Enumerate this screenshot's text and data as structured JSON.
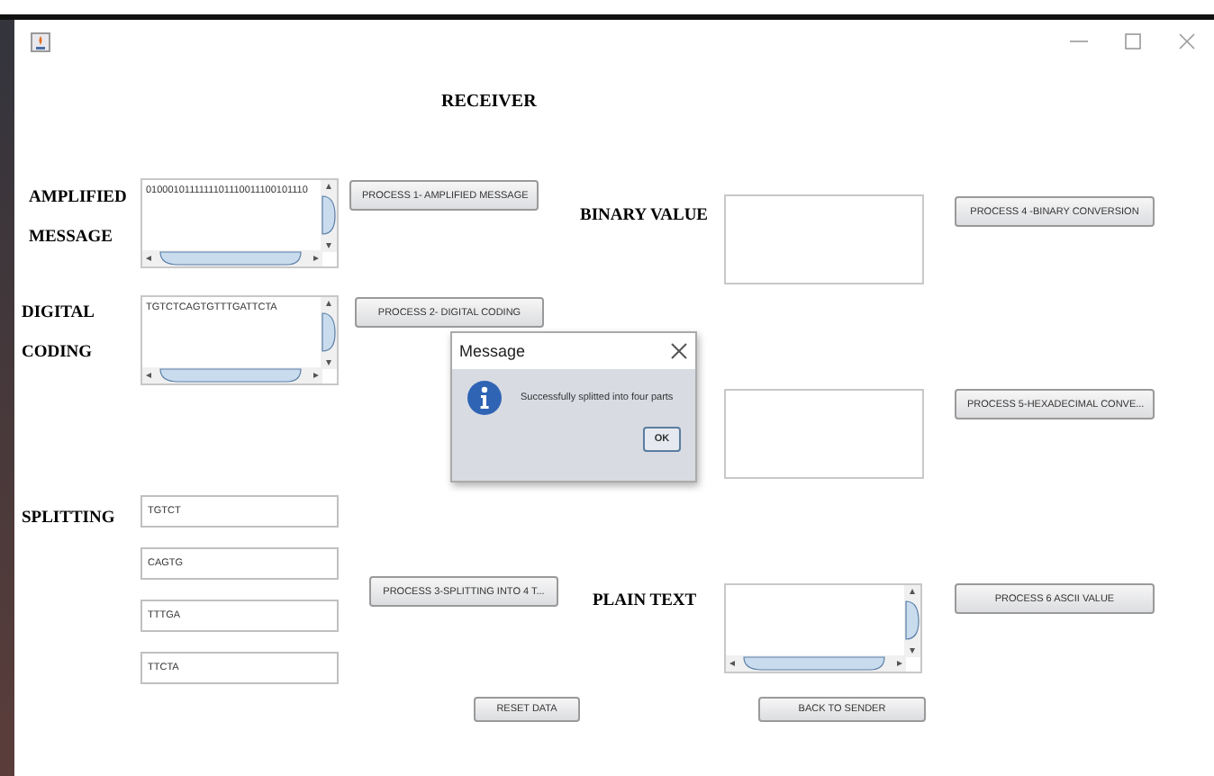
{
  "heading": "RECEIVER",
  "left": [
    {
      "kind": "textarea",
      "label": "AMPLIFIED MESSAGE",
      "value": "0100010111111101110011100101110",
      "button": "PROCESS 1- AMPLIFIED MESSAGE"
    },
    {
      "kind": "textarea",
      "label": "DIGITAL CODING",
      "value": "TGTCTCAGTGTTTGATTCTA",
      "button": "PROCESS 2- DIGITAL CODING"
    },
    {
      "kind": "fields",
      "label": "SPLITTING",
      "values": [
        "TGTCT",
        "CAGTG",
        "TTTGA",
        "TTCTA"
      ],
      "button": "PROCESS 3-SPLITTING INTO 4 T..."
    }
  ],
  "right": [
    {
      "kind": "box",
      "label": "BINARY VALUE",
      "button": "PROCESS 4 -BINARY CONVERSION"
    },
    {
      "kind": "box",
      "button": "PROCESS 5-HEXADECIMAL CONVE..."
    },
    {
      "kind": "textarea",
      "label": "PLAIN TEXT",
      "button": "PROCESS  6 ASCII VALUE"
    }
  ],
  "bottom_buttons": [
    "RESET DATA",
    "BACK TO SENDER"
  ],
  "dialog": {
    "title": "Message",
    "message": "Successfully splitted  into four parts",
    "button": "OK"
  }
}
